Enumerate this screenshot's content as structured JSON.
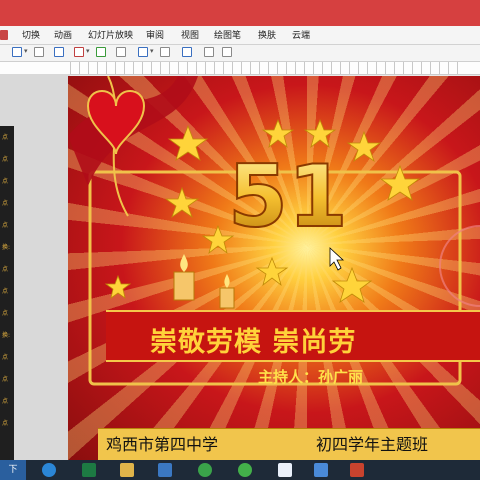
{
  "ribbon": {
    "tabs": [
      "切换",
      "动画",
      "幻灯片放映",
      "审阅",
      "视图",
      "绘图笔",
      "换肤",
      "云端"
    ]
  },
  "slide": {
    "emblem_text": "51",
    "banner_text": "崇敬劳模   崇尚劳",
    "host_text": "主持人：孙广丽",
    "school_text": "鸡西市第四中学",
    "class_text": "初四学年主题班"
  },
  "left_panel": {
    "labels": [
      "点",
      "点",
      "点",
      "点",
      "点",
      "换:",
      "点",
      "点",
      "点",
      "换:",
      "点",
      "点",
      "点",
      "点"
    ]
  },
  "taskbar": {
    "start_label": "下",
    "apps": [
      "edge-icon",
      "excel-icon",
      "files-icon",
      "monitor-icon",
      "wechat-icon",
      "chat-icon",
      "send-icon",
      "video-icon",
      "ppt-icon"
    ]
  },
  "colors": {
    "title_band": "#d64040",
    "slide_red": "#c61410",
    "gold": "#ffd23a",
    "strip": "#f1c54c"
  }
}
